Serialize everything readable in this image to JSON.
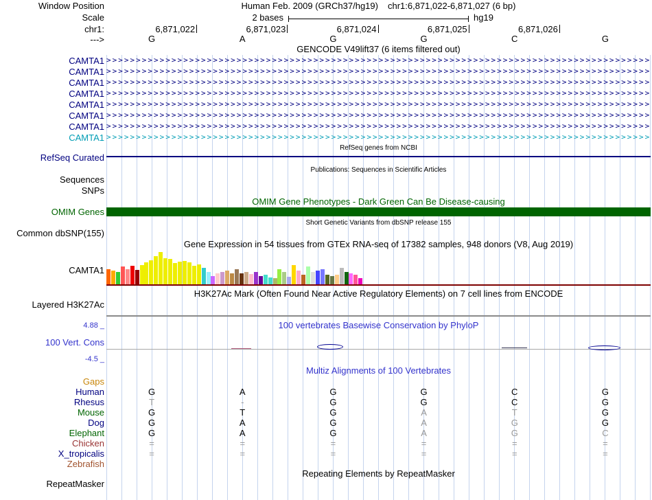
{
  "colors": {
    "navy": "#000080",
    "teal": "#009db5",
    "dark_green": "#006400",
    "blue_label": "#3333cc",
    "orange": "#c8860a",
    "gtex_baseline_red": "#7d0000",
    "dim_letter": "#999999"
  },
  "header": {
    "window_position_label": "Window Position",
    "assembly_text": "Human Feb. 2009 (GRCh37/hg19)",
    "position_text": "chr1:6,871,022-6,871,027 (6 bp)",
    "scale_label": "Scale",
    "scale_value": "2 bases",
    "assembly_short": "hg19",
    "chrom_label": "chr1:",
    "strand_label": "--->",
    "ruler_positions": [
      "6,871,022",
      "6,871,023",
      "6,871,024",
      "6,871,025",
      "6,871,026"
    ],
    "bases": [
      "G",
      "A",
      "G",
      "G",
      "C",
      "G"
    ]
  },
  "tracks": {
    "gencode": {
      "title": "GENCODE V49lift37 (6 items filtered out)",
      "arrow_glyph": ">",
      "genes": [
        {
          "label": "CAMTA1",
          "color": "#000080"
        },
        {
          "label": "CAMTA1",
          "color": "#000080"
        },
        {
          "label": "CAMTA1",
          "color": "#000080"
        },
        {
          "label": "CAMTA1",
          "color": "#000080"
        },
        {
          "label": "CAMTA1",
          "color": "#000080"
        },
        {
          "label": "CAMTA1",
          "color": "#000080"
        },
        {
          "label": "CAMTA1",
          "color": "#000080"
        },
        {
          "label": "CAMTA1",
          "color": "#009db5"
        }
      ]
    },
    "refseq": {
      "title": "RefSeq genes from NCBI",
      "label": "RefSeq Curated"
    },
    "publications": {
      "title": "Publications: Sequences in Scientific Articles",
      "sequences_label": "Sequences",
      "snps_label": "SNPs"
    },
    "omim": {
      "title": "OMIM Gene Phenotypes - Dark Green Can Be Disease-causing",
      "label": "OMIM Genes"
    },
    "dbsnp": {
      "title": "Short Genetic Variants from dbSNP release 155",
      "label": "Common dbSNP(155)"
    },
    "gtex": {
      "title": "Gene Expression in 54 tissues from GTEx RNA-seq of 17382 samples, 948 donors (V8, Aug 2019)",
      "label": "CAMTA1",
      "bars": [
        {
          "h": 22,
          "c": "#ff6600"
        },
        {
          "h": 20,
          "c": "#ffaa00"
        },
        {
          "h": 18,
          "c": "#33cc33"
        },
        {
          "h": 26,
          "c": "#ff5555"
        },
        {
          "h": 22,
          "c": "#ff8888"
        },
        {
          "h": 27,
          "c": "#ee0000"
        },
        {
          "h": 21,
          "c": "#990000"
        },
        {
          "h": 28,
          "c": "#eeee00"
        },
        {
          "h": 32,
          "c": "#eeee00"
        },
        {
          "h": 35,
          "c": "#eeee00"
        },
        {
          "h": 41,
          "c": "#eeee00"
        },
        {
          "h": 47,
          "c": "#eeee00"
        },
        {
          "h": 38,
          "c": "#eeee00"
        },
        {
          "h": 37,
          "c": "#eeee00"
        },
        {
          "h": 31,
          "c": "#eeee00"
        },
        {
          "h": 33,
          "c": "#eeee00"
        },
        {
          "h": 34,
          "c": "#eeee00"
        },
        {
          "h": 32,
          "c": "#eeee00"
        },
        {
          "h": 27,
          "c": "#eeee00"
        },
        {
          "h": 29,
          "c": "#eeee00"
        },
        {
          "h": 24,
          "c": "#33cccc"
        },
        {
          "h": 18,
          "c": "#99eeff"
        },
        {
          "h": 12,
          "c": "#cc66ff"
        },
        {
          "h": 16,
          "c": "#ffcccc"
        },
        {
          "h": 18,
          "c": "#cc99cc"
        },
        {
          "h": 20,
          "c": "#ddaa66"
        },
        {
          "h": 16,
          "c": "#bb8844"
        },
        {
          "h": 22,
          "c": "#997755"
        },
        {
          "h": 16,
          "c": "#663311"
        },
        {
          "h": 18,
          "c": "#ccaa88"
        },
        {
          "h": 15,
          "c": "#ffbbcc"
        },
        {
          "h": 18,
          "c": "#9933cc"
        },
        {
          "h": 12,
          "c": "#660099"
        },
        {
          "h": 14,
          "c": "#44ddcc"
        },
        {
          "h": 10,
          "c": "#44ddcc"
        },
        {
          "h": 9,
          "c": "#aabb66"
        },
        {
          "h": 22,
          "c": "#99ee44"
        },
        {
          "h": 18,
          "c": "#aacc88"
        },
        {
          "h": 11,
          "c": "#aaaaee"
        },
        {
          "h": 28,
          "c": "#ffd700"
        },
        {
          "h": 20,
          "c": "#ffaacc"
        },
        {
          "h": 14,
          "c": "#bb6622"
        },
        {
          "h": 26,
          "c": "#aaffaa"
        },
        {
          "h": 18,
          "c": "#dddddd"
        },
        {
          "h": 20,
          "c": "#4444ff"
        },
        {
          "h": 22,
          "c": "#7777ff"
        },
        {
          "h": 14,
          "c": "#556622"
        },
        {
          "h": 12,
          "c": "#667744"
        },
        {
          "h": 14,
          "c": "#ffcc88"
        },
        {
          "h": 24,
          "c": "#bbbbbb"
        },
        {
          "h": 18,
          "c": "#116611"
        },
        {
          "h": 16,
          "c": "#ff66ff"
        },
        {
          "h": 14,
          "c": "#ff5599"
        },
        {
          "h": 9,
          "c": "#ee00bb"
        }
      ]
    },
    "h3k27ac": {
      "title": "H3K27Ac Mark (Often Found Near Active Regulatory Elements) on 7 cell lines from ENCODE",
      "label": "Layered H3K27Ac"
    },
    "phylop": {
      "title": "100 vertebrates Basewise Conservation by PhyloP",
      "label": "100 Vert. Cons",
      "max_value": "4.88 _",
      "min_value": "-4.5 _"
    },
    "multiz": {
      "title": "Multiz Alignments of 100 Vertebrates",
      "species": [
        {
          "name": "Gaps",
          "color": "#c8860a",
          "cells": []
        },
        {
          "name": "Human",
          "color": "#000080",
          "cells": [
            {
              "t": "G"
            },
            {
              "t": "A"
            },
            {
              "t": "G"
            },
            {
              "t": "G"
            },
            {
              "t": "C"
            },
            {
              "t": "G"
            }
          ]
        },
        {
          "name": "Rhesus",
          "color": "#000080",
          "cells": [
            {
              "t": "T",
              "dim": true
            },
            {
              "t": "-",
              "dim": true
            },
            {
              "t": "G"
            },
            {
              "t": "G"
            },
            {
              "t": "C"
            },
            {
              "t": "G"
            }
          ]
        },
        {
          "name": "Mouse",
          "color": "#006400",
          "cells": [
            {
              "t": "G"
            },
            {
              "t": "T"
            },
            {
              "t": "G"
            },
            {
              "t": "A",
              "dim": true
            },
            {
              "t": "T",
              "dim": true
            },
            {
              "t": "G"
            }
          ]
        },
        {
          "name": "Dog",
          "color": "#000080",
          "cells": [
            {
              "t": "G"
            },
            {
              "t": "A"
            },
            {
              "t": "G"
            },
            {
              "t": "A",
              "dim": true
            },
            {
              "t": "G",
              "dim": true
            },
            {
              "t": "G"
            }
          ]
        },
        {
          "name": "Elephant",
          "color": "#006400",
          "cells": [
            {
              "t": "G"
            },
            {
              "t": "A"
            },
            {
              "t": "G"
            },
            {
              "t": "A",
              "dim": true
            },
            {
              "t": "G",
              "dim": true
            },
            {
              "t": "C",
              "dim": true
            }
          ]
        },
        {
          "name": "Chicken",
          "color": "#993333",
          "cells": [
            {
              "t": "=",
              "dim": true
            },
            {
              "t": "=",
              "dim": true
            },
            {
              "t": "=",
              "dim": true
            },
            {
              "t": "=",
              "dim": true
            },
            {
              "t": "=",
              "dim": true
            },
            {
              "t": "=",
              "dim": true
            }
          ]
        },
        {
          "name": "X_tropicalis",
          "color": "#000080",
          "cells": [
            {
              "t": "=",
              "dim": true
            },
            {
              "t": "=",
              "dim": true
            },
            {
              "t": "=",
              "dim": true
            },
            {
              "t": "=",
              "dim": true
            },
            {
              "t": "=",
              "dim": true
            },
            {
              "t": "=",
              "dim": true
            }
          ]
        },
        {
          "name": "Zebrafish",
          "color": "#a0522d",
          "cells": []
        }
      ]
    },
    "repeatmasker": {
      "title": "Repeating Elements by RepeatMasker",
      "label": "RepeatMasker"
    }
  }
}
